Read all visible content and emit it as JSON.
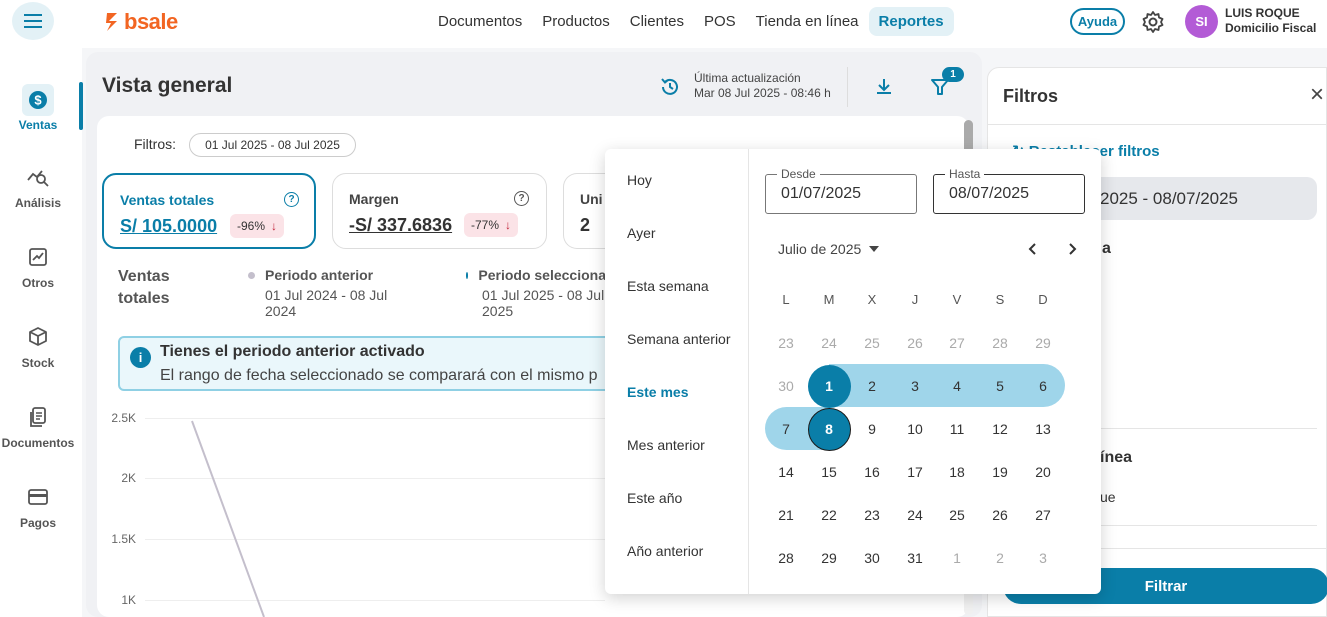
{
  "brand": {
    "logo_text": "bsale"
  },
  "nav": {
    "items": [
      "Documentos",
      "Productos",
      "Clientes",
      "POS",
      "Tienda en línea",
      "Reportes"
    ],
    "active": "Reportes"
  },
  "header": {
    "help": "Ayuda",
    "avatar_initials": "SI",
    "user_name": "LUIS ROQUE",
    "user_sub": "Domicilio Fiscal"
  },
  "sidebar": {
    "items": [
      {
        "label": "Ventas",
        "icon": "dollar-icon",
        "active": true
      },
      {
        "label": "Análisis",
        "icon": "chart-search-icon",
        "active": false
      },
      {
        "label": "Otros",
        "icon": "trend-icon",
        "active": false
      },
      {
        "label": "Stock",
        "icon": "box-icon",
        "active": false
      },
      {
        "label": "Documentos",
        "icon": "document-icon",
        "active": false
      },
      {
        "label": "Pagos",
        "icon": "card-icon",
        "active": false
      }
    ]
  },
  "main": {
    "title": "Vista general",
    "update_label": "Última actualización",
    "update_time": "Mar 08 Jul 2025 - 08:46 h",
    "filter_badge": "1",
    "filtros_label": "Filtros:",
    "range_chip": "01 Jul 2025 - 08 Jul 2025",
    "kpis": [
      {
        "title": "Ventas totales",
        "value": "S/ 105.0000",
        "pct": "-96%"
      },
      {
        "title": "Margen",
        "value": "-S/ 337.6836",
        "pct": "-77%"
      },
      {
        "title": "Uni",
        "value": "2"
      }
    ],
    "section_title": "Ventas totales",
    "legend": [
      {
        "title": "Periodo anterior",
        "range": "01 Jul 2024 - 08 Jul 2024",
        "color": "#c4bfcc"
      },
      {
        "title": "Periodo selecciona",
        "range": "01 Jul 2025 - 08 Jul 2025",
        "color": "#0a7ea8"
      }
    ],
    "info_title": "Tienes el periodo anterior activado",
    "info_text": "El rango de fecha seleccionado se comparará con el mismo p",
    "y_ticks": [
      "2.5K",
      "2K",
      "1.5K",
      "1K"
    ]
  },
  "filter_panel": {
    "title": "Filtros",
    "reset": "Restablecer filtros",
    "date_value": "2025 - 08/07/2025",
    "frag1": "a",
    "frag2": "ínea",
    "frag3": "ue",
    "submit": "Filtrar"
  },
  "picker": {
    "presets": [
      "Hoy",
      "Ayer",
      "Esta semana",
      "Semana anterior",
      "Este mes",
      "Mes anterior",
      "Este año",
      "Año anterior"
    ],
    "active_preset": "Este mes",
    "from_label": "Desde",
    "from_value": "01/07/2025",
    "to_label": "Hasta",
    "to_value": "08/07/2025",
    "month_label": "Julio de 2025",
    "dow": [
      "L",
      "M",
      "X",
      "J",
      "V",
      "S",
      "D"
    ],
    "weeks": [
      [
        "23",
        "24",
        "25",
        "26",
        "27",
        "28",
        "29"
      ],
      [
        "30",
        "1",
        "2",
        "3",
        "4",
        "5",
        "6"
      ],
      [
        "7",
        "8",
        "9",
        "10",
        "11",
        "12",
        "13"
      ],
      [
        "14",
        "15",
        "16",
        "17",
        "18",
        "19",
        "20"
      ],
      [
        "21",
        "22",
        "23",
        "24",
        "25",
        "26",
        "27"
      ],
      [
        "28",
        "29",
        "30",
        "31",
        "1",
        "2",
        "3"
      ]
    ]
  }
}
